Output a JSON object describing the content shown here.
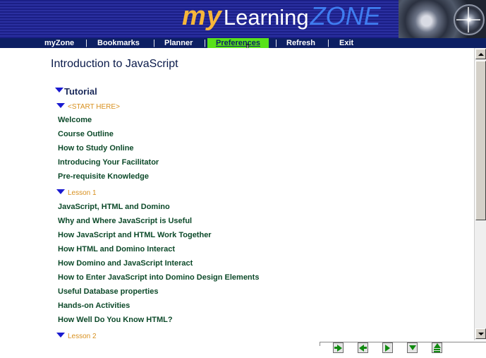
{
  "header": {
    "logo_my": "my",
    "logo_learning": "Learning",
    "logo_zone": "ZONE"
  },
  "nav": {
    "items": [
      {
        "label": "myZone"
      },
      {
        "label": "Bookmarks"
      },
      {
        "label": "Planner"
      },
      {
        "label": "Preferences",
        "active": true
      },
      {
        "label": "Refresh"
      },
      {
        "label": "Exit"
      }
    ],
    "separator": "|",
    "active_color": "#58e21a",
    "bar_color": "#0c1f63"
  },
  "content": {
    "title": "Introduction to JavaScript",
    "tutorial_label": "Tutorial",
    "start_label": "<START HERE>",
    "start_items": [
      "Welcome",
      "Course Outline",
      "How to Study Online",
      "Introducing Your Facilitator",
      "Pre-requisite Knowledge"
    ],
    "lesson1_label": "Lesson 1",
    "lesson1_items": [
      "JavaScript, HTML and Domino",
      "Why and Where JavaScript is Useful",
      "How JavaScript and HTML Work Together",
      "How HTML and Domino Interact",
      "How Domino and JavaScript Interact",
      "How to Enter JavaScript into Domino Design Elements",
      "Useful Database properties",
      "Hands-on Activities",
      "How Well Do You Know HTML?"
    ],
    "lesson2_label": "Lesson 2"
  },
  "toolbar": {
    "buttons": [
      {
        "icon": "next-arrow-icon"
      },
      {
        "icon": "previous-arrow-icon"
      },
      {
        "icon": "play-arrow-icon"
      },
      {
        "icon": "down-arrow-icon"
      },
      {
        "icon": "top-arrow-icon"
      }
    ]
  }
}
